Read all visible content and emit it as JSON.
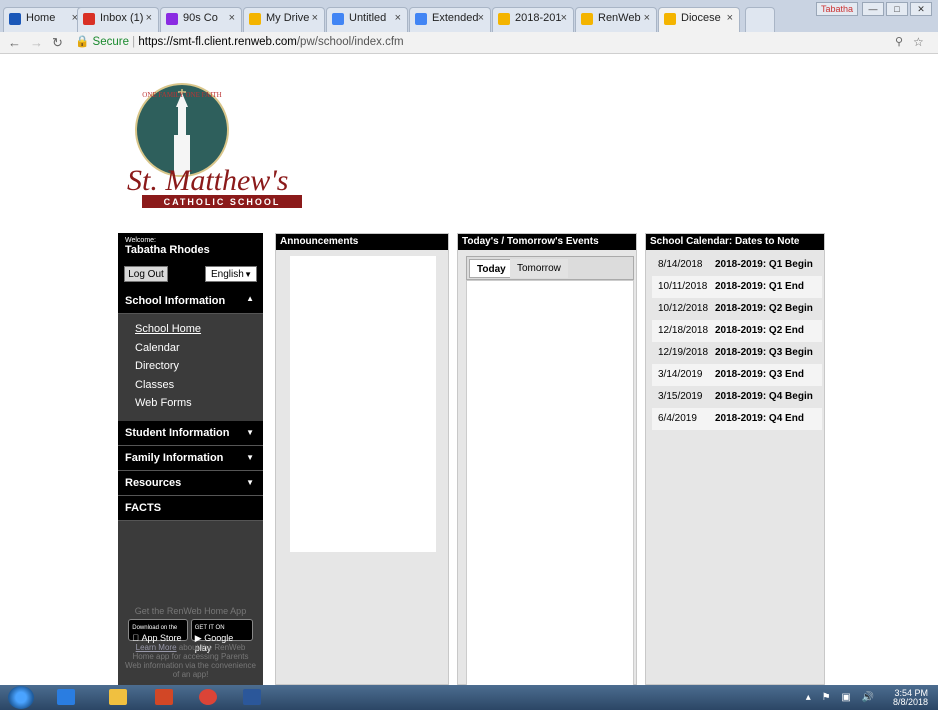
{
  "browser": {
    "tabs": [
      {
        "label": "Home",
        "color": "#1a57b8"
      },
      {
        "label": "Inbox (1)",
        "color": "#d93025"
      },
      {
        "label": "90s Co",
        "color": "#8a2be2"
      },
      {
        "label": "My Drive",
        "color": "#f4b400"
      },
      {
        "label": "Untitled",
        "color": "#4285f4"
      },
      {
        "label": "Extended",
        "color": "#4285f4"
      },
      {
        "label": "2018-201",
        "color": "#f4b400"
      },
      {
        "label": "RenWeb",
        "color": "#f4b400"
      },
      {
        "label": "Diocese",
        "color": "#f4b400"
      }
    ],
    "user_badge": "Tabatha",
    "secure_label": "Secure",
    "url_host": "https://smt-fl.client.renweb.com",
    "url_path": "/pw/school/index.cfm"
  },
  "school": {
    "logo_top": "ONE FAMILY ONE FAITH",
    "logo_name": "St. Matthew's",
    "logo_sub": "CATHOLIC SCHOOL"
  },
  "sidebar": {
    "welcome_label": "Welcome:",
    "user_name": "Tabatha Rhodes",
    "logout_label": "Log Out",
    "language": "English",
    "sections": {
      "school_info": "School Information",
      "student_info": "Student Information",
      "family_info": "Family Information",
      "resources": "Resources",
      "facts": "FACTS"
    },
    "school_links": [
      "School Home",
      "Calendar",
      "Directory",
      "Classes",
      "Web Forms"
    ],
    "app_promo": "Get the RenWeb Home App",
    "app_store": "App Store",
    "app_store_small": "Download on the",
    "google_play": "Google play",
    "google_play_small": "GET IT ON",
    "learn_more": "Learn More",
    "learn_more_text": "about the RenWeb Home app for accessing Parents Web information via the convenience of an app!"
  },
  "announcements": {
    "title": "Announcements"
  },
  "events": {
    "title": "Today's / Tomorrow's Events",
    "tab_today": "Today",
    "tab_tomorrow": "Tomorrow"
  },
  "calendar": {
    "title": "School Calendar: Dates to Note",
    "rows": [
      {
        "date": "8/14/2018",
        "title": "2018-2019: Q1 Begin"
      },
      {
        "date": "10/11/2018",
        "title": "2018-2019: Q1 End"
      },
      {
        "date": "10/12/2018",
        "title": "2018-2019: Q2 Begin"
      },
      {
        "date": "12/18/2018",
        "title": "2018-2019: Q2 End"
      },
      {
        "date": "12/19/2018",
        "title": "2018-2019: Q3 Begin"
      },
      {
        "date": "3/14/2019",
        "title": "2018-2019: Q3 End"
      },
      {
        "date": "3/15/2019",
        "title": "2018-2019: Q4 Begin"
      },
      {
        "date": "6/4/2019",
        "title": "2018-2019: Q4 End"
      }
    ]
  },
  "taskbar": {
    "time": "3:54 PM",
    "date": "8/8/2018"
  }
}
